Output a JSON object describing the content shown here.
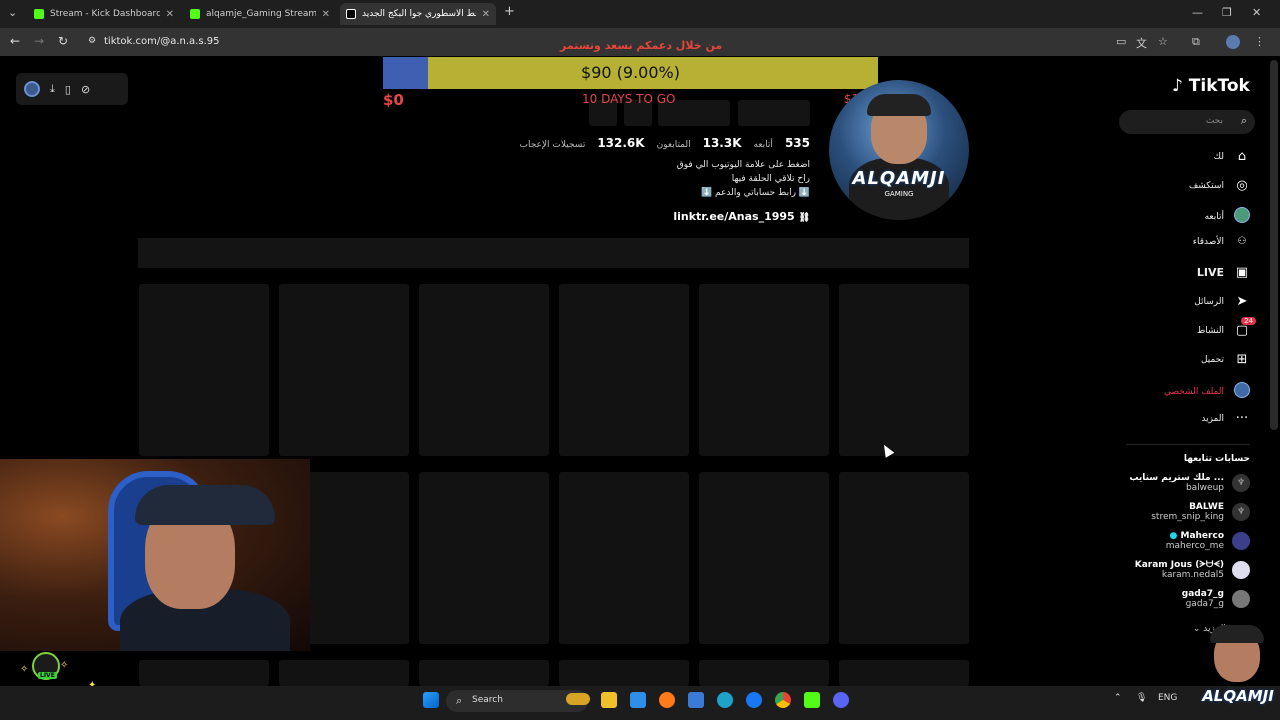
{
  "browser": {
    "tabs": [
      {
        "title": "Stream - Kick Dashboard",
        "icon": "kick-icon",
        "color": "#53fc18"
      },
      {
        "title": "alqamje_Gaming Stream - Wat",
        "icon": "kick-icon",
        "color": "#53fc18"
      },
      {
        "title": "الخط الاسطوري جوا البكج الجديد",
        "icon": "tiktok-icon",
        "color": "#ffffff"
      }
    ],
    "new_tab": "+",
    "url": "tiktok.com/@a.n.a.s.95",
    "banner_text": "من خلال دعمكم نسعد ونستمر"
  },
  "donation_goal": {
    "amount_label": "$90 (9.00%)",
    "progress_fraction": 0.09,
    "start_label": "$0",
    "days_label": "10 DAYS TO GO",
    "end_label": "$1000",
    "fill_color": "#3f5fb2",
    "bar_color": "#b6b134"
  },
  "profile": {
    "avatar_text": "ALQAMJI",
    "avatar_subtext": "GAMING",
    "stats": [
      {
        "num": "535",
        "label": "أتابعه"
      },
      {
        "num": "13.3K",
        "label": "المتابعون"
      },
      {
        "num": "132.6K",
        "label": "تسجيلات الإعجاب"
      }
    ],
    "bio_lines": [
      "اضغط على علامة اليوتيوب الي فوق",
      "راح تلاقي الحلقة فيها",
      "⬇️ رابط حساباتي والدعم ⬇️"
    ],
    "link": "linktr.ee/Anas_1995"
  },
  "sidebar": {
    "logo": "TikTok",
    "search_placeholder": "بحث",
    "items": [
      {
        "label": "لك",
        "icon": "home-icon",
        "glyph": "⌂"
      },
      {
        "label": "استكشف",
        "icon": "compass-icon",
        "glyph": "◎"
      },
      {
        "label": "أتابعه",
        "icon": "following-avatar-icon",
        "glyph": ""
      },
      {
        "label": "الأصدقاء",
        "icon": "friends-icon",
        "glyph": "👥"
      },
      {
        "label": "LIVE",
        "icon": "live-icon",
        "glyph": "▣"
      },
      {
        "label": "الرسائل",
        "icon": "messages-icon",
        "glyph": "➤"
      },
      {
        "label": "النشاط",
        "icon": "activity-icon",
        "glyph": "▢",
        "badge": "24"
      },
      {
        "label": "تحميل",
        "icon": "upload-icon",
        "glyph": "⊞"
      },
      {
        "label": "الملف الشخصي",
        "icon": "profile-avatar-icon",
        "glyph": ""
      },
      {
        "label": "المزيد",
        "icon": "more-icon",
        "glyph": "···"
      }
    ],
    "following_title": "حسابات تتابعها",
    "following": [
      {
        "name": "ملك ستريم سنايب ...",
        "handle": "balweup"
      },
      {
        "name": "BALWE",
        "handle": "strem_snip_king"
      },
      {
        "name": "Maherco",
        "handle": "maherco_me",
        "verified": true
      },
      {
        "name": "Karam Jous (ᗒᗨᗕ)",
        "handle": "karam.nedal5"
      },
      {
        "name": "gada7_g",
        "handle": "gada7_g"
      }
    ],
    "see_more": "عرض المزيد"
  },
  "overlay": {
    "live_label": "LIVE",
    "corner_logo": "ALQAMJI"
  },
  "taskbar": {
    "search_label": "Search",
    "lang": "ENG",
    "icons": [
      "windows-start-icon",
      "widgets-icon",
      "file-explorer-icon",
      "tasks-icon",
      "firefox-icon",
      "mail-icon",
      "edge-icon",
      "facebook-icon",
      "chrome-icon",
      "kick-app-icon",
      "discord-icon"
    ]
  }
}
